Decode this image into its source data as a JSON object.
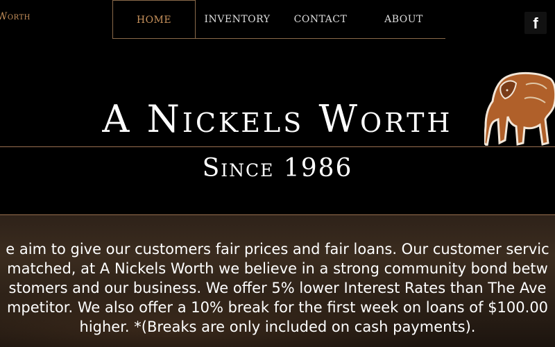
{
  "brand": {
    "text": "Worth"
  },
  "nav": {
    "items": [
      {
        "label": "HOME",
        "active": true
      },
      {
        "label": "INVENTORY",
        "active": false
      },
      {
        "label": "CONTACT",
        "active": false
      },
      {
        "label": "ABOUT",
        "active": false
      }
    ]
  },
  "social": {
    "facebook_glyph": "f",
    "icon": "facebook-icon"
  },
  "hero": {
    "title": "A Nickels Worth",
    "subtitle": "Since 1986",
    "logo_icon": "bison-icon"
  },
  "about": {
    "lines": [
      "e aim to give our customers fair prices and fair loans. Our customer servic",
      "matched,  at A Nickels Worth we believe in a strong community bond betw",
      "stomers and our business.  We offer 5% lower Interest Rates than The Ave",
      "mpetitor. We also offer a 10% break for the first week on loans of $100.00",
      "higher. *(Breaks are only included on cash payments)."
    ]
  },
  "colors": {
    "accent": "#c8925c",
    "background": "#000000",
    "rule": "#9a7050"
  }
}
